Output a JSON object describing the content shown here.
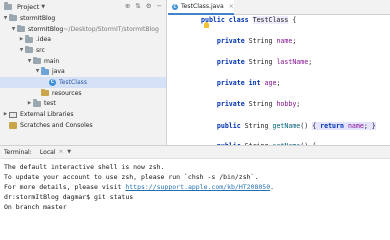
{
  "project_panel": {
    "title": "Project",
    "toolbar_icons": [
      "target-icon",
      "collapse-icon",
      "settings-icon",
      "minimize-icon"
    ],
    "toolbar_glyphs": [
      "⊕",
      "⇅",
      "⚙",
      "−"
    ],
    "tree": [
      {
        "label": "stormItBlog",
        "arrow": "▼",
        "icon": "folder",
        "indent": 1
      },
      {
        "label": "stormItBlog",
        "path": "~/Desktop/StormIT/stormItBlog",
        "arrow": "▼",
        "icon": "folder",
        "indent": 2
      },
      {
        "label": ".idea",
        "arrow": "▶",
        "icon": "folder",
        "indent": 3
      },
      {
        "label": "src",
        "arrow": "▼",
        "icon": "folder",
        "indent": 3
      },
      {
        "label": "main",
        "arrow": "▼",
        "icon": "folder",
        "indent": 4
      },
      {
        "label": "java",
        "arrow": "▼",
        "icon": "folder-blue",
        "indent": 5
      },
      {
        "label": "TestClass",
        "arrow": "",
        "icon": "class",
        "indent": 6,
        "selected": true
      },
      {
        "label": "resources",
        "arrow": "",
        "icon": "folder-gold",
        "indent": 5
      },
      {
        "label": "test",
        "arrow": "▶",
        "icon": "folder",
        "indent": 4
      },
      {
        "label": "External Libraries",
        "arrow": "▶",
        "icon": "library",
        "indent": 1
      },
      {
        "label": "Scratches and Consoles",
        "arrow": "",
        "icon": "scratches",
        "indent": 1
      }
    ]
  },
  "editor": {
    "tab": {
      "label": "TestClass.java",
      "icon": "class-icon",
      "close": "×"
    },
    "class_icon_letter": "C",
    "lines": [
      {
        "parts": [
          {
            "t": "public class ",
            "c": "kw"
          },
          {
            "t": "TestClass",
            "c": "cls-hl"
          },
          {
            "t": " {",
            "c": ""
          }
        ]
      },
      {
        "parts": [
          {
            "t": "    private ",
            "c": "kw"
          },
          {
            "t": "String ",
            "c": ""
          },
          {
            "t": "name",
            "c": "fld"
          },
          {
            "t": ";",
            "c": ""
          }
        ]
      },
      {
        "parts": [
          {
            "t": "    private ",
            "c": "kw"
          },
          {
            "t": "String ",
            "c": ""
          },
          {
            "t": "lastName",
            "c": "fld"
          },
          {
            "t": ";",
            "c": ""
          }
        ]
      },
      {
        "parts": [
          {
            "t": "    private int ",
            "c": "kw"
          },
          {
            "t": "age",
            "c": "fld"
          },
          {
            "t": ";",
            "c": ""
          }
        ]
      },
      {
        "parts": [
          {
            "t": "    private ",
            "c": "kw"
          },
          {
            "t": "String ",
            "c": ""
          },
          {
            "t": "hobby",
            "c": "fld"
          },
          {
            "t": ";",
            "c": ""
          }
        ]
      },
      {
        "parts": [
          {
            "t": "    public ",
            "c": "kw"
          },
          {
            "t": "String ",
            "c": ""
          },
          {
            "t": "getName",
            "c": "mth"
          },
          {
            "t": "() ",
            "c": ""
          },
          {
            "t": "{ ",
            "c": "fold-hl"
          },
          {
            "t": "return ",
            "c": "kw fold-hl"
          },
          {
            "t": "name",
            "c": "fld fold-hl"
          },
          {
            "t": "; }",
            "c": "fold-hl"
          }
        ]
      },
      {
        "parts": [
          {
            "t": "    public ",
            "c": "kw"
          },
          {
            "t": "String ",
            "c": ""
          },
          {
            "t": "setName",
            "c": "mth"
          },
          {
            "t": "() {",
            "c": ""
          }
        ]
      }
    ]
  },
  "terminal": {
    "title": "Terminal:",
    "tab_label": "Local",
    "tab_close": "×",
    "lines": [
      {
        "text": "The default interactive shell is now zsh."
      },
      {
        "text": "To update your account to use zsh, please run `chsh -s /bin/zsh`."
      },
      {
        "text": "For more details, please visit ",
        "link": "https://support.apple.com/kb/HT208050",
        "after": "."
      },
      {
        "text": "dr:stormItBlog dagmar$ git status"
      },
      {
        "text": "On branch master"
      }
    ]
  }
}
